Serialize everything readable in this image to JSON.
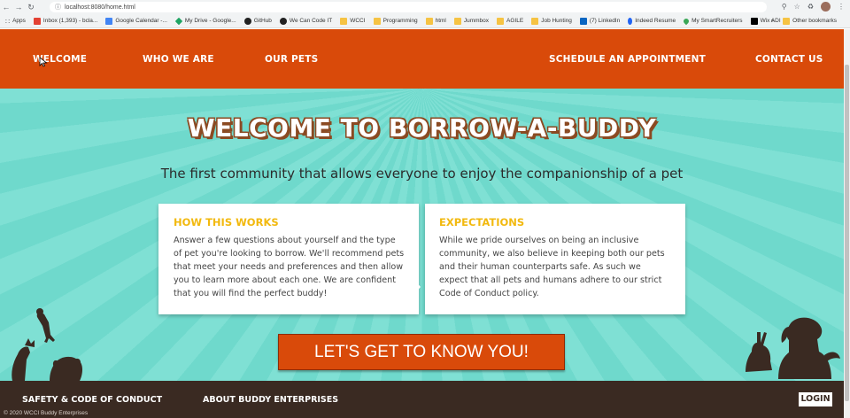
{
  "browser": {
    "url": "localhost:8080/home.html",
    "bookmarks": [
      {
        "label": "Apps",
        "icon": "apps-grid-icon"
      },
      {
        "label": "Inbox (1,393) - bcla...",
        "icon": "gmail-icon"
      },
      {
        "label": "Google Calendar -...",
        "icon": "calendar-icon"
      },
      {
        "label": "My Drive - Google...",
        "icon": "drive-icon"
      },
      {
        "label": "GitHub",
        "icon": "github-icon"
      },
      {
        "label": "We Can Code IT",
        "icon": "github-icon"
      },
      {
        "label": "WCCI",
        "icon": "folder-icon"
      },
      {
        "label": "Programming",
        "icon": "folder-icon"
      },
      {
        "label": "html",
        "icon": "folder-icon"
      },
      {
        "label": "Jummbox",
        "icon": "folder-icon"
      },
      {
        "label": "AGILE",
        "icon": "folder-icon"
      },
      {
        "label": "Job Hunting",
        "icon": "folder-icon"
      },
      {
        "label": "(7) LinkedIn",
        "icon": "linkedin-icon"
      },
      {
        "label": "Indeed Resume",
        "icon": "indeed-icon"
      },
      {
        "label": "My SmartRecruiters",
        "icon": "smartrecruiters-icon"
      },
      {
        "label": "Wix ADI",
        "icon": "wix-icon"
      }
    ],
    "more_bookmarks": "»",
    "other_bookmarks": "Other bookmarks"
  },
  "nav": {
    "welcome": "WELCOME",
    "who_we_are": "WHO WE ARE",
    "our_pets": "OUR PETS",
    "schedule": "SCHEDULE AN APPOINTMENT",
    "contact": "CONTACT US"
  },
  "hero": {
    "title": "WELCOME TO BORROW-A-BUDDY",
    "subtitle": "The first community that allows everyone to enjoy the companionship of a pet"
  },
  "cards": {
    "how": {
      "heading": "HOW THIS WORKS",
      "body": "Answer a few questions about yourself and the type of pet you're looking to borrow. We'll recommend pets that meet your needs and preferences and then allow you to learn more about each one. We are confident that you will find the perfect buddy!"
    },
    "expectations": {
      "heading": "EXPECTATIONS",
      "body": "While we pride ourselves on being an inclusive community, we also believe in keeping both our pets and their human counterparts safe. As such we expect that all pets and humans adhere to our strict Code of Conduct policy."
    }
  },
  "cta": "LET'S GET TO KNOW YOU!",
  "footer": {
    "safety": "SAFETY & CODE OF CONDUCT",
    "about": "ABOUT BUDDY ENTERPRISES",
    "login": "LOGIN",
    "copyright": "© 2020 WCCI Buddy Enterprises"
  },
  "colors": {
    "nav_bg": "#d94a0a",
    "hero_teal": "#78dcd0",
    "card_heading": "#f2b90f",
    "footer_bg": "#3a2a22"
  }
}
